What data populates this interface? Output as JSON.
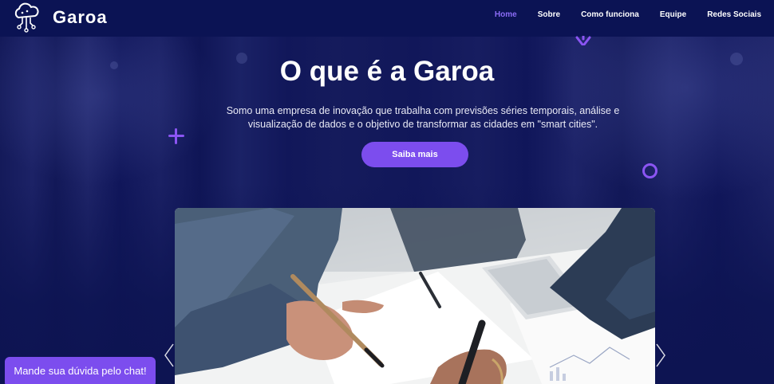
{
  "brand": {
    "name": "Garoa",
    "logo_icon": "cloud-circuit-icon"
  },
  "nav": {
    "items": [
      {
        "label": "Home",
        "active": true
      },
      {
        "label": "Sobre",
        "active": false
      },
      {
        "label": "Como funciona",
        "active": false
      },
      {
        "label": "Equipe",
        "active": false
      },
      {
        "label": "Redes Sociais",
        "active": false
      }
    ]
  },
  "hero": {
    "title": "O que é a Garoa",
    "subtitle": "Somo uma empresa de inovação que trabalha com previsões séries temporais, análise e visualização de dados e o objetivo de transformar as cidades em \"smart cities\".",
    "cta_label": "Saiba mais"
  },
  "carousel": {
    "image": "business-people-writing-on-documents-photo",
    "prev_icon": "chevron-left-icon",
    "next_icon": "chevron-right-icon"
  },
  "chat": {
    "label": "Mande sua dúvida pelo chat!"
  },
  "colors": {
    "navbar_bg": "#0b1354",
    "page_bg": "#0d1452",
    "accent": "#7c4dee",
    "active_link": "#8b6cf6",
    "decoration": "#8b55f3"
  }
}
